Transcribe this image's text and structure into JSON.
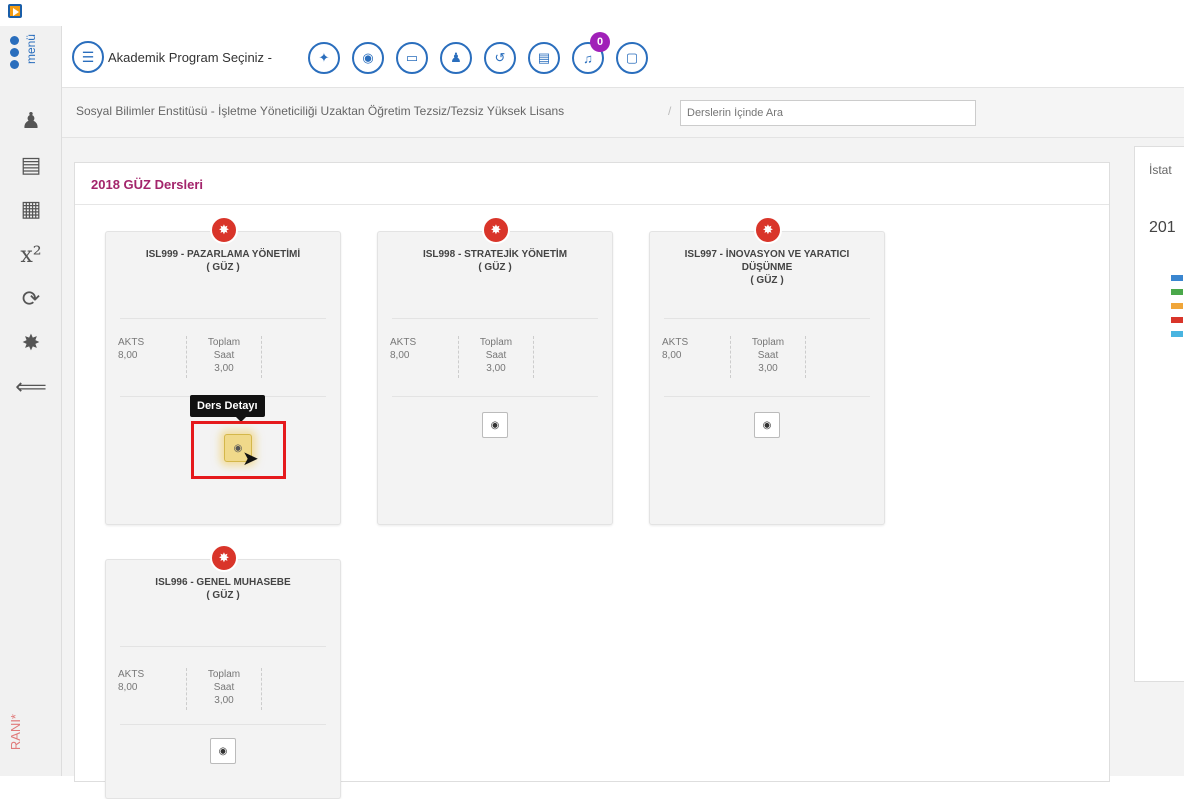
{
  "toolbar": {
    "program_select_label": "Akademik Program Seçiniz -",
    "notification_count": "0",
    "tools": [
      {
        "name": "compass-icon",
        "glyph": "✦"
      },
      {
        "name": "eye-icon",
        "glyph": "◉"
      },
      {
        "name": "card-icon",
        "glyph": "▭"
      },
      {
        "name": "user-icon",
        "glyph": "♟"
      },
      {
        "name": "history-icon",
        "glyph": "↺"
      },
      {
        "name": "document-icon",
        "glyph": "▤"
      },
      {
        "name": "bell-icon",
        "glyph": "♫"
      },
      {
        "name": "calendar-icon",
        "glyph": "▢"
      }
    ]
  },
  "breadcrumb": {
    "path": "Sosyal Bilimler Enstitüsü - İşletme Yöneticiliği Uzaktan Öğretim Tezsiz/Tezsiz Yüksek Lisans",
    "separator": "/",
    "search_placeholder": "Derslerin İçinde Ara"
  },
  "panel": {
    "title": "2018 GÜZ Dersleri"
  },
  "courses": [
    {
      "code_name": "ISL999 - PAZARLAMA YÖNETİMİ",
      "term": "( GÜZ )",
      "akts_label": "AKTS",
      "akts_value": "8,00",
      "total_label_1": "Toplam",
      "total_label_2": "Saat",
      "total_value": "3,00"
    },
    {
      "code_name": "ISL998 - STRATEJİK YÖNETİM",
      "term": "( GÜZ )",
      "akts_label": "AKTS",
      "akts_value": "8,00",
      "total_label_1": "Toplam",
      "total_label_2": "Saat",
      "total_value": "3,00"
    },
    {
      "code_name": "ISL997 - İNOVASYON VE YARATICI DÜŞÜNME",
      "term": "( GÜZ )",
      "akts_label": "AKTS",
      "akts_value": "8,00",
      "total_label_1": "Toplam",
      "total_label_2": "Saat",
      "total_value": "3,00"
    },
    {
      "code_name": "ISL996 - GENEL MUHASEBE",
      "term": "( GÜZ )",
      "akts_label": "AKTS",
      "akts_value": "8,00",
      "total_label_1": "Toplam",
      "total_label_2": "Saat",
      "total_value": "3,00"
    }
  ],
  "tooltip": {
    "text": "Ders Detayı"
  },
  "stats": {
    "title": "İstat",
    "year": "201",
    "legend_colors": [
      "#3a86d0",
      "#4aa84a",
      "#f0a63a",
      "#d9352a",
      "#49b4e0"
    ]
  },
  "sidebar": {
    "menu_label": "menü",
    "watermark": "RANI*"
  }
}
